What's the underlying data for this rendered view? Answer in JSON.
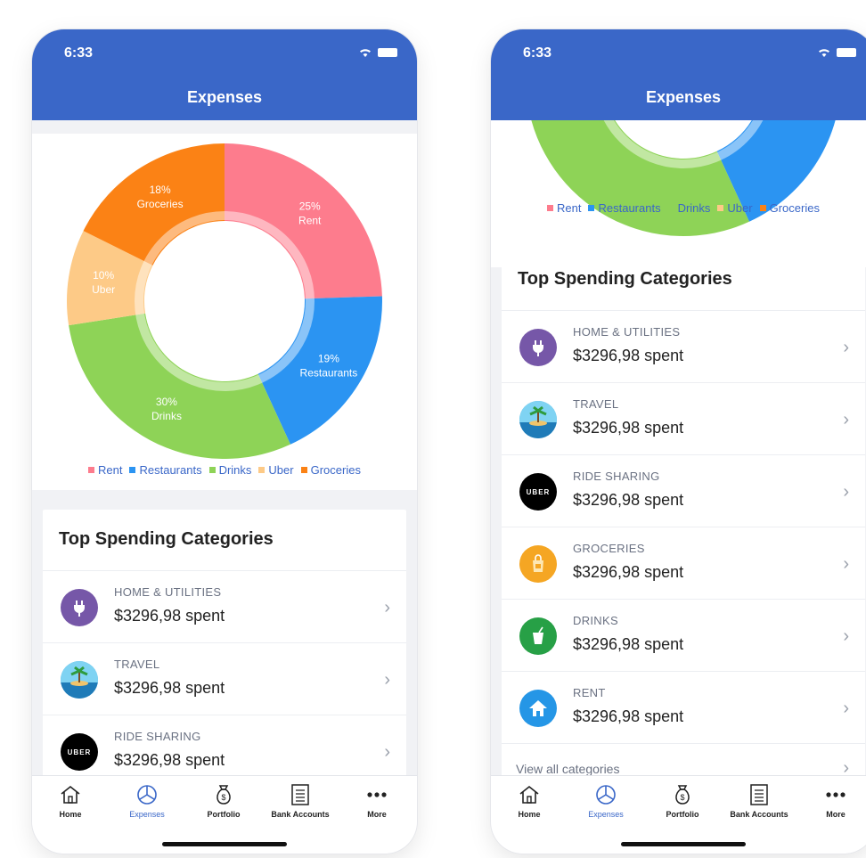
{
  "status": {
    "time": "6:33"
  },
  "header": {
    "title": "Expenses"
  },
  "chart_data": {
    "type": "pie",
    "title": "",
    "slices": [
      {
        "name": "Rent",
        "percent": 25,
        "label": "25%",
        "color": "#fd7c8d"
      },
      {
        "name": "Restaurants",
        "percent": 19,
        "label": "19%",
        "color": "#2b94f2"
      },
      {
        "name": "Drinks",
        "percent": 30,
        "label": "30%",
        "color": "#8ed357"
      },
      {
        "name": "Uber",
        "percent": 10,
        "label": "10%",
        "color": "#fdca87"
      },
      {
        "name": "Groceries",
        "percent": 18,
        "label": "18%",
        "color": "#fb8215"
      }
    ],
    "legend": {
      "position": "bottom"
    }
  },
  "section": {
    "title": "Top Spending Categories",
    "view_all": "View all categories"
  },
  "categories": [
    {
      "name": "HOME & UTILITIES",
      "amount": "$3296,98 spent",
      "icon": "plug-icon",
      "color": "#7657a8"
    },
    {
      "name": "TRAVEL",
      "amount": "$3296,98 spent",
      "icon": "island-icon",
      "color": "#38a6d9"
    },
    {
      "name": "RIDE SHARING",
      "amount": "$3296,98 spent",
      "icon": "uber-icon",
      "color": "#000000",
      "icon_text": "UBER"
    },
    {
      "name": "GROCERIES",
      "amount": "$3296,98 spent",
      "icon": "grocery-bag-icon",
      "color": "#f5a623"
    },
    {
      "name": "DRINKS",
      "amount": "$3296,98 spent",
      "icon": "drink-cup-icon",
      "color": "#27a046"
    },
    {
      "name": "RENT",
      "amount": "$3296,98 spent",
      "icon": "house-icon",
      "color": "#2596e6"
    }
  ],
  "tabs": [
    {
      "label": "Home",
      "icon": "home-icon"
    },
    {
      "label": "Expenses",
      "icon": "pie-chart-icon",
      "active": true
    },
    {
      "label": "Portfolio",
      "icon": "money-bag-icon"
    },
    {
      "label": "Bank Accounts",
      "icon": "ledger-icon"
    },
    {
      "label": "More",
      "icon": "more-icon"
    }
  ]
}
